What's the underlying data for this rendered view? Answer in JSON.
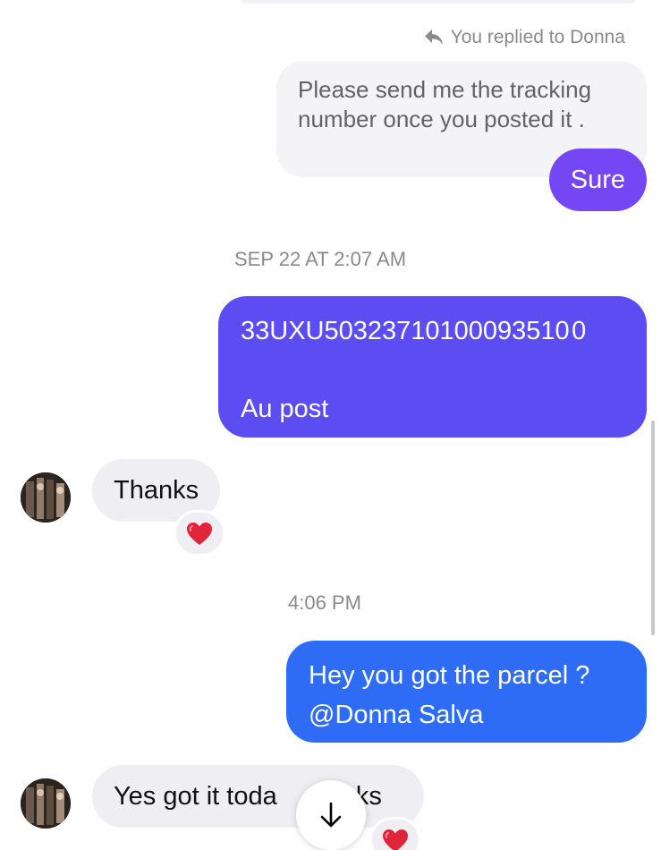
{
  "conversation": {
    "reply_meta": {
      "text": "You replied to Donna",
      "icon": "reply-arrow-icon"
    },
    "quoted_message": {
      "line1": "Please send me the tracking",
      "line2": "number once you posted it ."
    },
    "messages": [
      {
        "id": "sure",
        "direction": "outgoing",
        "text": "Sure",
        "color": "#7546f4"
      },
      {
        "id": "ts1",
        "type": "timestamp",
        "text": "SEP 22 AT 2:07 AM"
      },
      {
        "id": "tracking",
        "direction": "outgoing",
        "line1": "33UXU50323710100093510 0",
        "line2": "Au post",
        "color": "#5b4df2"
      },
      {
        "id": "thanks",
        "direction": "incoming",
        "text": "Thanks",
        "reaction": "heart"
      },
      {
        "id": "ts2",
        "type": "timestamp",
        "text": "4:06 PM"
      },
      {
        "id": "hey",
        "direction": "outgoing",
        "line1": "Hey you got the parcel ?",
        "line2": "@Donna Salva",
        "color": "#2f6cf6"
      },
      {
        "id": "yes",
        "direction": "incoming",
        "text_left": "Yes got it toda",
        "text_right": "nks",
        "reaction": "heart"
      }
    ]
  },
  "controls": {
    "scroll_down_icon": "arrow-down-icon"
  },
  "colors": {
    "incoming_bubble": "#efeff3",
    "quoted_bubble": "#f4f4f6",
    "meta_text": "#8a8a8e",
    "heart": "#e0243a"
  }
}
